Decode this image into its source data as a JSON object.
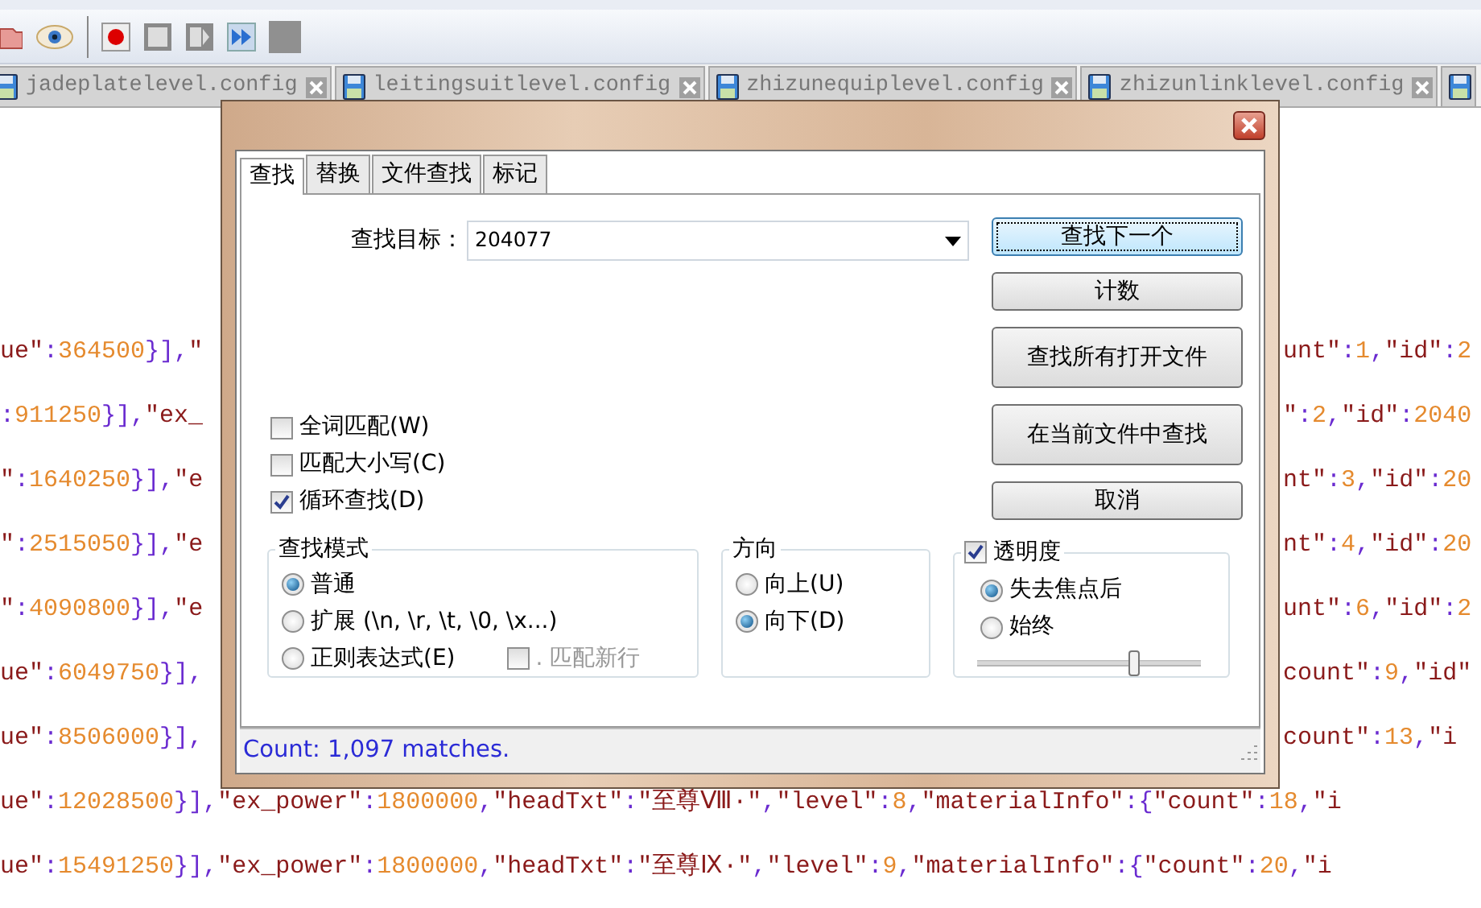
{
  "file_tabs": [
    {
      "label": "jadeplatelevel.config",
      "selected": false
    },
    {
      "label": "leitingsuitlevel.config",
      "selected": false
    },
    {
      "label": "zhizunequiplevel.config",
      "selected": false
    },
    {
      "label": "zhizunlinklevel.config",
      "selected": false
    }
  ],
  "editor": {
    "lines": [
      {
        "left": "ue\":364500}],\"",
        "right": "unt\":1,\"id\":2"
      },
      {
        "left": ":911250}],\"ex_",
        "right": "\":2,\"id\":2040"
      },
      {
        "left": "\":1640250}],\"e",
        "right": "nt\":3,\"id\":20"
      },
      {
        "left": "\":2515050}],\"e",
        "right": "nt\":4,\"id\":20"
      },
      {
        "left": "\":4090800}],\"e",
        "right": "unt\":6,\"id\":2"
      },
      {
        "left": "ue\":6049750}],",
        "right": "count\":9,\"id\""
      },
      {
        "left": "ue\":8506000}],",
        "right": "count\":13,\"i"
      },
      {
        "text": "ue\":12028500}],\"ex_power\":1800000,\"headTxt\":\"至尊Ⅷ·\",\"level\":8,\"materialInfo\":{\"count\":18,\"i"
      },
      {
        "text": "ue\":15491250}],\"ex_power\":1800000,\"headTxt\":\"至尊Ⅸ·\",\"level\":9,\"materialInfo\":{\"count\":20,\"i"
      }
    ]
  },
  "dialog": {
    "tabs": [
      {
        "label": "查找",
        "selected": true
      },
      {
        "label": "替换",
        "selected": false
      },
      {
        "label": "文件查找",
        "selected": false
      },
      {
        "label": "标记",
        "selected": false
      }
    ],
    "find_label": "查找目标：",
    "find_value": "204077",
    "buttons": [
      {
        "label": "查找下一个",
        "kind": "normal",
        "focused": true
      },
      {
        "label": "计数",
        "kind": "normal",
        "focused": false
      },
      {
        "label": "查找所有打开文件",
        "kind": "tall",
        "focused": false
      },
      {
        "label": "在当前文件中查找",
        "kind": "tall",
        "focused": false
      },
      {
        "label": "取消",
        "kind": "normal",
        "focused": false
      }
    ],
    "options": [
      {
        "label": "全词匹配(W)",
        "checked": false
      },
      {
        "label": "匹配大小写(C)",
        "checked": false
      },
      {
        "label": "循环查找(D)",
        "checked": true
      }
    ],
    "mode": {
      "title": "查找模式",
      "options": [
        {
          "label": "普通",
          "selected": true
        },
        {
          "label": "扩展 (\\n, \\r, \\t, \\0, \\x...)",
          "selected": false
        },
        {
          "label": "正则表达式(E)",
          "selected": false
        }
      ],
      "dot_newline": {
        "label": ". 匹配新行",
        "checked": false,
        "disabled": true
      }
    },
    "direction": {
      "title": "方向",
      "options": [
        {
          "label": "向上(U)",
          "selected": false
        },
        {
          "label": "向下(D)",
          "selected": true
        }
      ]
    },
    "transparency": {
      "label": "透明度",
      "checked": true,
      "options": [
        {
          "label": "失去焦点后",
          "selected": true
        },
        {
          "label": "始终",
          "selected": false
        }
      ],
      "level": 0.72
    },
    "status": "Count: 1,097 matches."
  }
}
